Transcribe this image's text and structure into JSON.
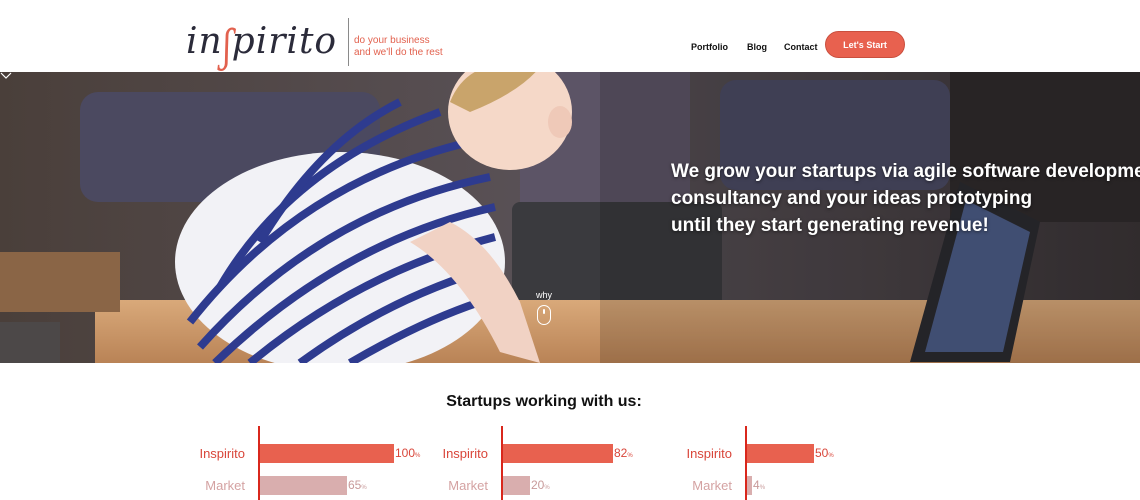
{
  "header": {
    "logo_word_a": "in",
    "logo_word_s": "ʃ",
    "logo_word_b": "pirito",
    "tagline_line1": "do your business",
    "tagline_line2": "and we'll do the rest",
    "nav": [
      "Portfolio",
      "Blog",
      "Contact"
    ],
    "cta_label": "Let's Start"
  },
  "hero": {
    "headline_lines": [
      "We grow your startups via agile software development,",
      "consultancy and your ideas prototyping",
      "until they start generating revenue!"
    ],
    "scroll_label": "why"
  },
  "stats": {
    "title": "Startups working with us:",
    "groups": [
      {
        "rows": [
          {
            "label": "Inspirito",
            "value": 100,
            "unit": "%"
          },
          {
            "label": "Market",
            "value": 65,
            "unit": "%"
          }
        ]
      },
      {
        "rows": [
          {
            "label": "Inspirito",
            "value": 82,
            "unit": "%"
          },
          {
            "label": "Market",
            "value": 20,
            "unit": "%"
          }
        ]
      },
      {
        "rows": [
          {
            "label": "Inspirito",
            "value": 50,
            "unit": "%"
          },
          {
            "label": "Market",
            "value": 4,
            "unit": "%"
          }
        ]
      }
    ]
  },
  "colors": {
    "accent": "#e8614f",
    "accent_dark": "#d9271c",
    "market_bar": "#d9aeae"
  }
}
